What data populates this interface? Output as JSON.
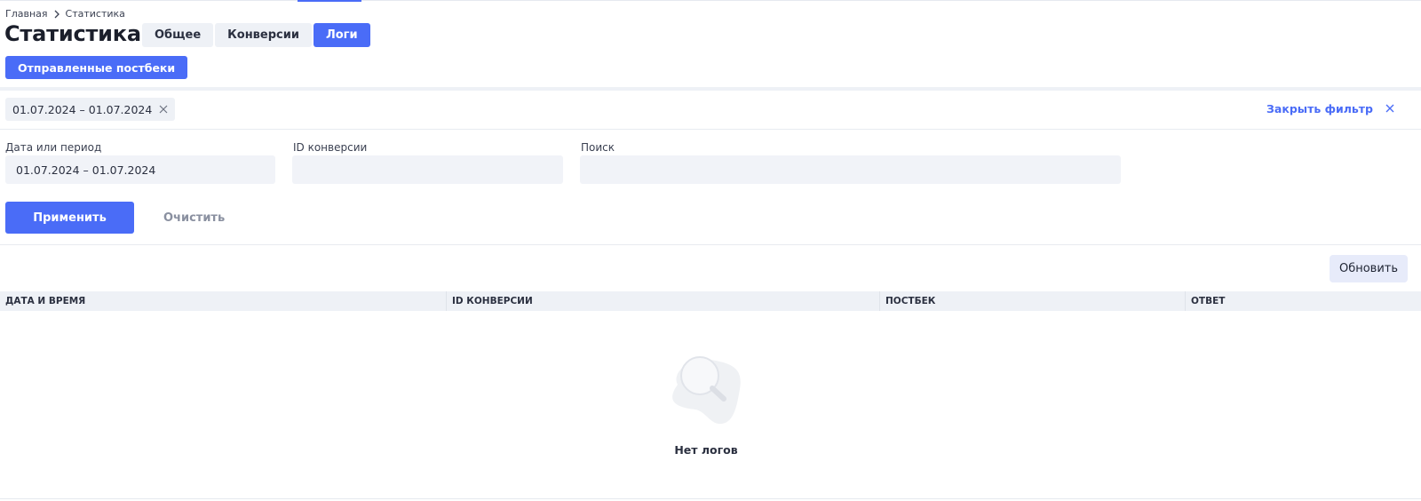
{
  "breadcrumb": {
    "home": "Главная",
    "current": "Статистика"
  },
  "page": {
    "title": "Статистика"
  },
  "tabs": [
    {
      "label": "Общее",
      "active": false
    },
    {
      "label": "Конверсии",
      "active": false
    },
    {
      "label": "Логи",
      "active": true
    }
  ],
  "toolbar": {
    "postbacks_label": "Отправленные постбеки"
  },
  "filter": {
    "chip_value": "01.07.2024 – 01.07.2024",
    "close_label": "Закрыть фильтр",
    "date_label": "Дата или период",
    "date_value": "01.07.2024 – 01.07.2024",
    "conversion_label": "ID конверсии",
    "conversion_value": "",
    "search_label": "Поиск",
    "search_value": "",
    "apply_label": "Применить",
    "clear_label": "Очистить"
  },
  "actions": {
    "refresh_label": "Обновить"
  },
  "table": {
    "columns": [
      "ДАТА И ВРЕМЯ",
      "ID КОНВЕРСИИ",
      "ПОСТБЕК",
      "ОТВЕТ"
    ],
    "rows": []
  },
  "empty_state": {
    "text": "Нет логов",
    "icon": "magnifier-icon"
  },
  "colors": {
    "accent": "#4a6cf7",
    "surface": "#eef1f6",
    "input": "#f1f3f8",
    "muted": "#8a90a0"
  }
}
